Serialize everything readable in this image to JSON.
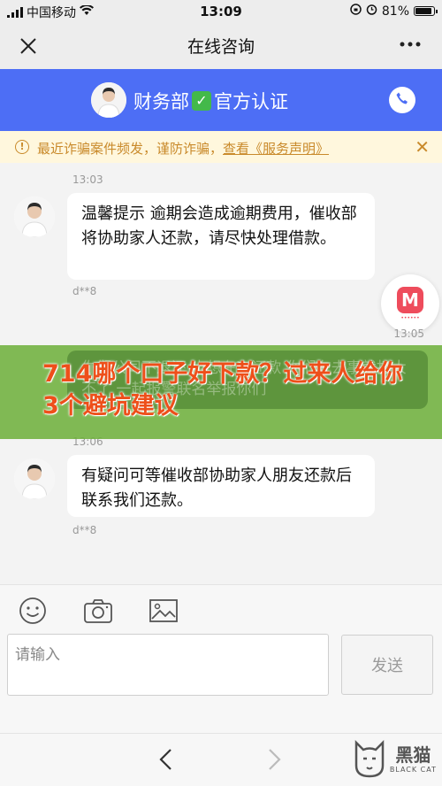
{
  "status_bar": {
    "carrier": "中国移动",
    "time": "13:09",
    "battery": "81%"
  },
  "nav": {
    "title": "在线咨询"
  },
  "agent": {
    "name_prefix": "财务部",
    "name_suffix": "官方认证"
  },
  "notice": {
    "text": "最近诈骗案件频发，谨防诈骗，",
    "link": "查看《服务声明》"
  },
  "messages": [
    {
      "time": "13:03",
      "text": "温馨提示 逾期会造成逾期费用，催收部将协助家人还款，请尽快处理借款。",
      "meta": "d**8"
    },
    {
      "time": "13:05",
      "text": "你们公司不退还 也想在次还款 你们在去事就打大不了 一起报警联名举报你们",
      "meta": ""
    },
    {
      "time": "13:06",
      "text": "有疑问可等催收部协助家人朋友还款后联系我们还款。",
      "meta": "d**8"
    }
  ],
  "promo": {
    "text": "714哪个口子好下款？过来人给你3个避坑建议"
  },
  "input": {
    "placeholder": "请输入",
    "send_label": "发送"
  },
  "watermark": {
    "cn": "黑猫",
    "en": "BLACK CAT"
  },
  "colors": {
    "header_blue": "#4d6ef5",
    "notice_text": "#c98a2b",
    "promo_green": "#70b03e",
    "promo_text": "#ee4f1a"
  }
}
